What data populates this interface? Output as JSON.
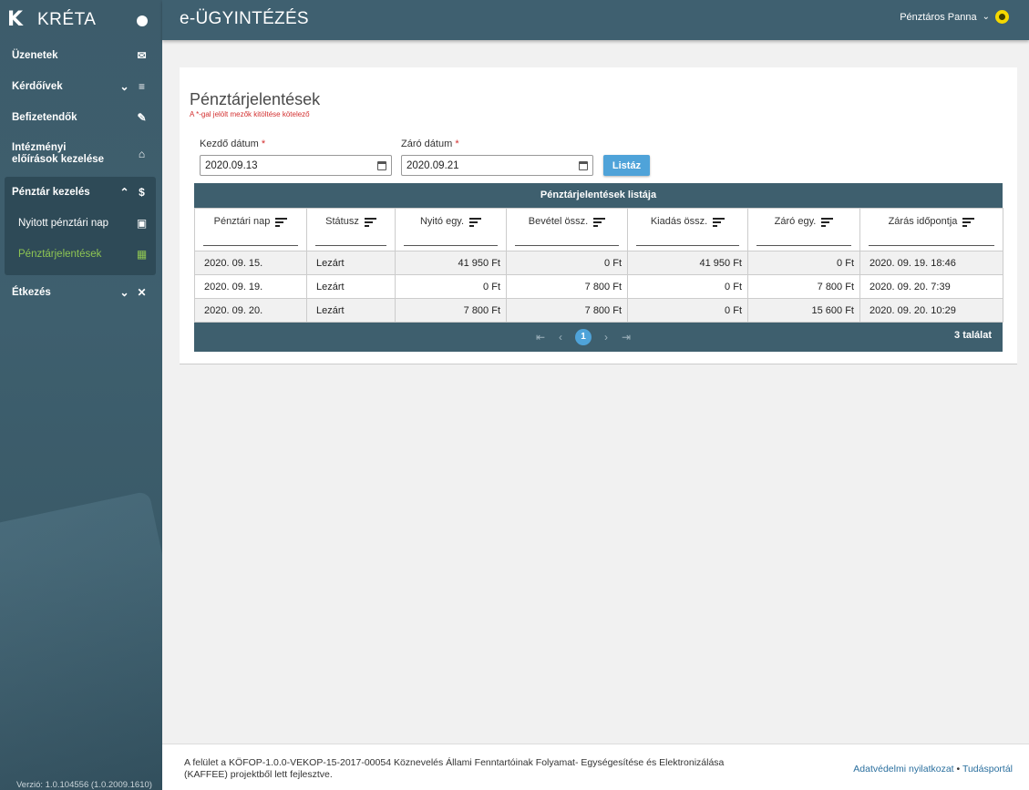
{
  "brand": {
    "logo": "K",
    "name": "KRÉTA"
  },
  "sidebar": {
    "items": [
      {
        "label": "Üzenetek",
        "icon": "mail-icon"
      },
      {
        "label": "Kérdőívek",
        "icon": "list-icon"
      },
      {
        "label": "Befizetendők",
        "icon": "payment-icon"
      },
      {
        "label": "Intézményi előírások kezelése",
        "icon": "bank-icon"
      },
      {
        "label": "Pénztár kezelés",
        "icon": "dollar-icon",
        "children": [
          {
            "label": "Nyitott pénztári nap",
            "icon": "calendar-icon"
          },
          {
            "label": "Pénztárjelentések",
            "icon": "table-icon",
            "active": true
          }
        ]
      },
      {
        "label": "Étkezés",
        "icon": "cutlery-icon"
      }
    ],
    "version": "Verzió: 1.0.104556 (1.0.2009.1610)"
  },
  "header": {
    "title": "e-ÜGYINTÉZÉS",
    "user": "Pénztáros Panna"
  },
  "page": {
    "title": "Pénztárjelentések",
    "required_note": "A *-gal jelölt mezők kitöltése kötelező",
    "start_label": "Kezdő dátum",
    "start_value": "2020.09.13",
    "end_label": "Záró dátum",
    "end_value": "2020.09.21",
    "star": "*",
    "list_button": "Listáz"
  },
  "grid": {
    "title": "Pénztárjelentések listája",
    "columns": [
      "Pénztári nap",
      "Státusz",
      "Nyitó egy.",
      "Bevétel össz.",
      "Kiadás össz.",
      "Záró egy.",
      "Zárás időpontja"
    ],
    "rows": [
      [
        "2020. 09. 15.",
        "Lezárt",
        "41 950 Ft",
        "0 Ft",
        "41 950 Ft",
        "0 Ft",
        "2020. 09. 19. 18:46"
      ],
      [
        "2020. 09. 19.",
        "Lezárt",
        "0 Ft",
        "7 800 Ft",
        "0 Ft",
        "7 800 Ft",
        "2020. 09. 20. 7:39"
      ],
      [
        "2020. 09. 20.",
        "Lezárt",
        "7 800 Ft",
        "7 800 Ft",
        "0 Ft",
        "15 600 Ft",
        "2020. 09. 20. 10:29"
      ]
    ],
    "current_page": "1",
    "result_count": "3 találat"
  },
  "footer": {
    "text": "A felület a KÖFOP-1.0.0-VEKOP-15-2017-00054 Köznevelés Állami Fenntartóinak Folyamat- Egységesítése és Elektronizálása (KAFFEE) projektből lett fejlesztve.",
    "privacy": "Adatvédelmi nyilatkozat",
    "separator": "•",
    "knowledge": "Tudásportál"
  },
  "colors": {
    "sidebar": "#3e5f6e",
    "accent": "#4fa3d9",
    "active_menu": "#8ec553",
    "required": "#d32f2f"
  }
}
